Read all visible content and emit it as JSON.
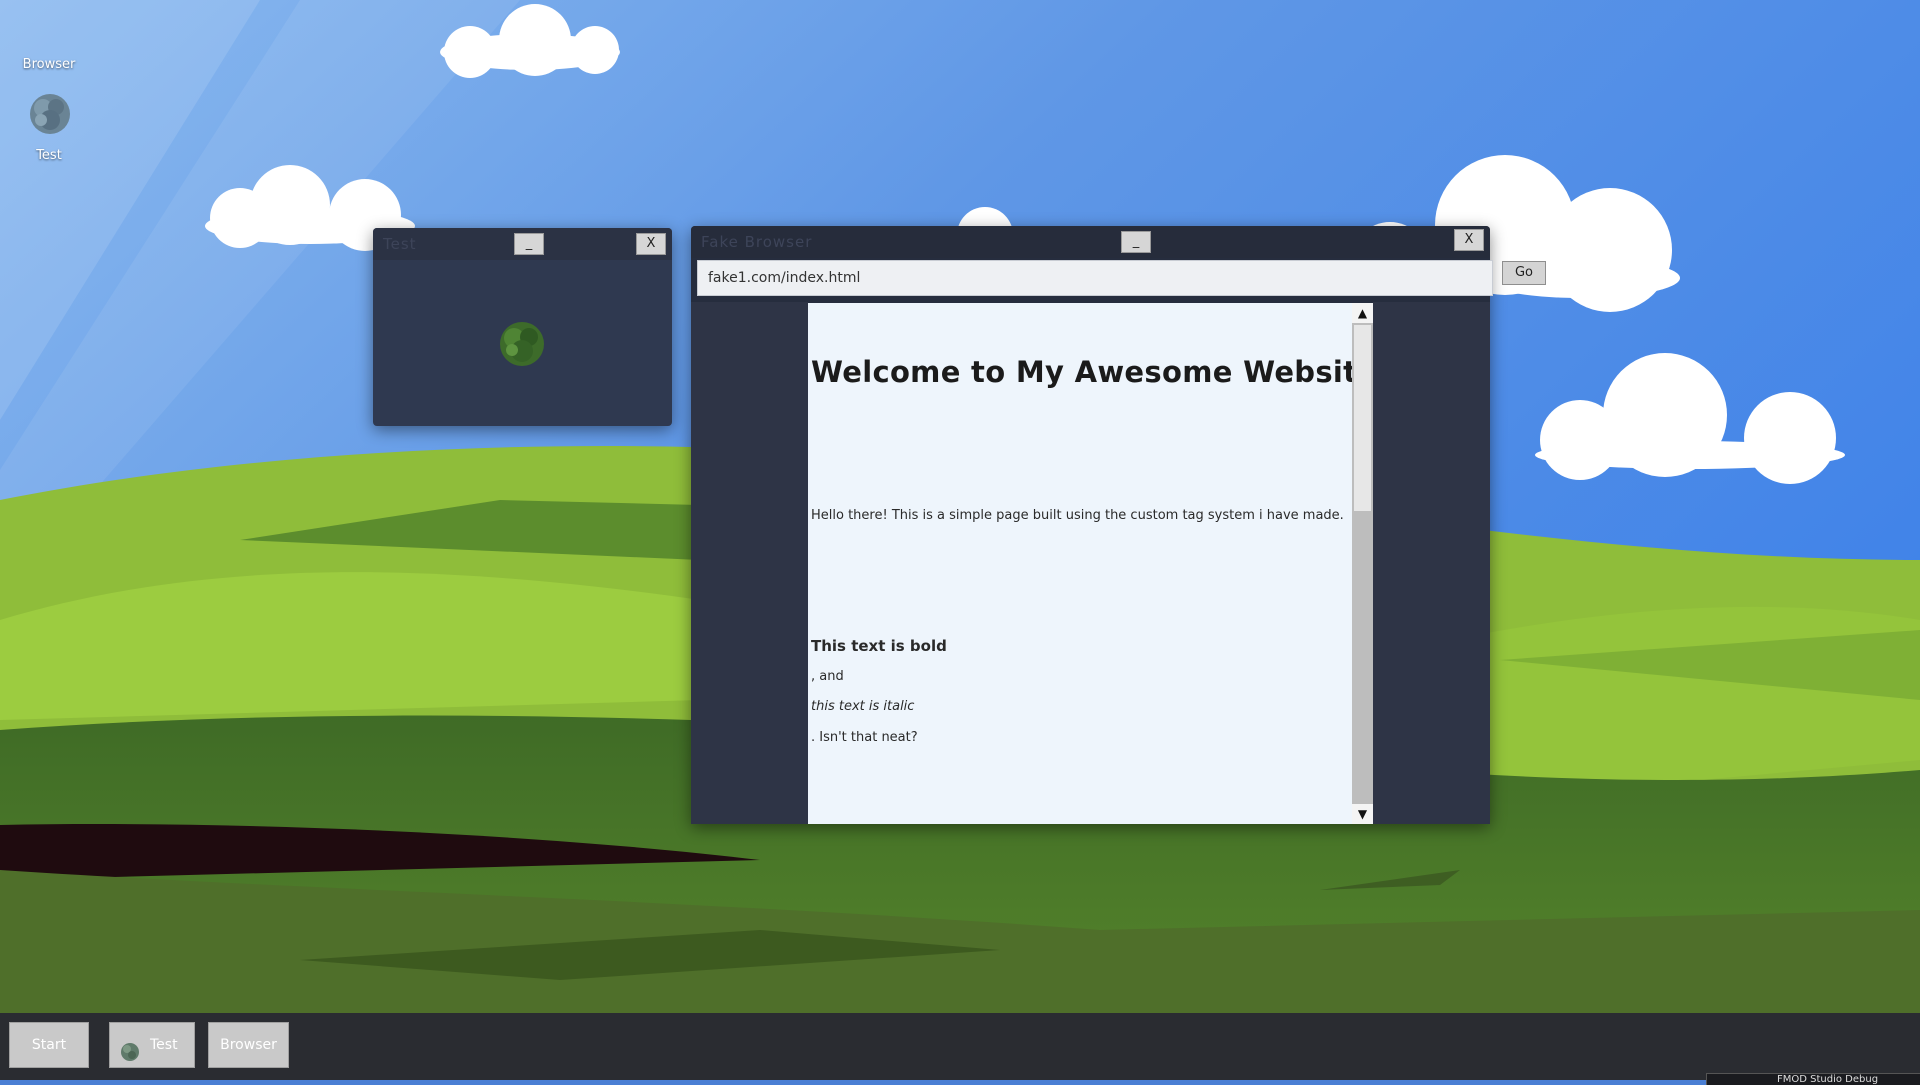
{
  "desktop": {
    "icons": [
      {
        "label_top": "Browser",
        "label_bottom": "Test",
        "icon": "tree-icon"
      }
    ]
  },
  "test_window": {
    "title": "Test",
    "minimize_label": "_",
    "close_label": "X",
    "content_icon": "tree-icon"
  },
  "browser_window": {
    "title": "Fake Browser",
    "minimize_label": "_",
    "close_label": "X",
    "url": "fake1.com/index.html",
    "go_label": "Go",
    "page": {
      "heading": "Welcome to My Awesome Website!",
      "paragraph": "Hello there! This is a simple page built using the custom tag system i have made.",
      "bold_text": "This text is bold",
      "and_text": ", and",
      "italic_text": "this text is italic",
      "end_text": ". Isn't that neat?"
    },
    "scroll_up": "▲",
    "scroll_down": "▼"
  },
  "taskbar": {
    "start_label": "Start",
    "items": [
      {
        "label": "Test",
        "icon": "tree-icon"
      },
      {
        "label": "Browser"
      }
    ],
    "tray_text": "FMOD Studio Debug"
  },
  "colors": {
    "sky": "#4a86e0",
    "hills_light": "#8fc23c",
    "hills_dark": "#4e7a2a",
    "window_bg": "#2f3950",
    "page_bg": "#eef5fc",
    "taskbar_bg": "#2a2c31"
  }
}
